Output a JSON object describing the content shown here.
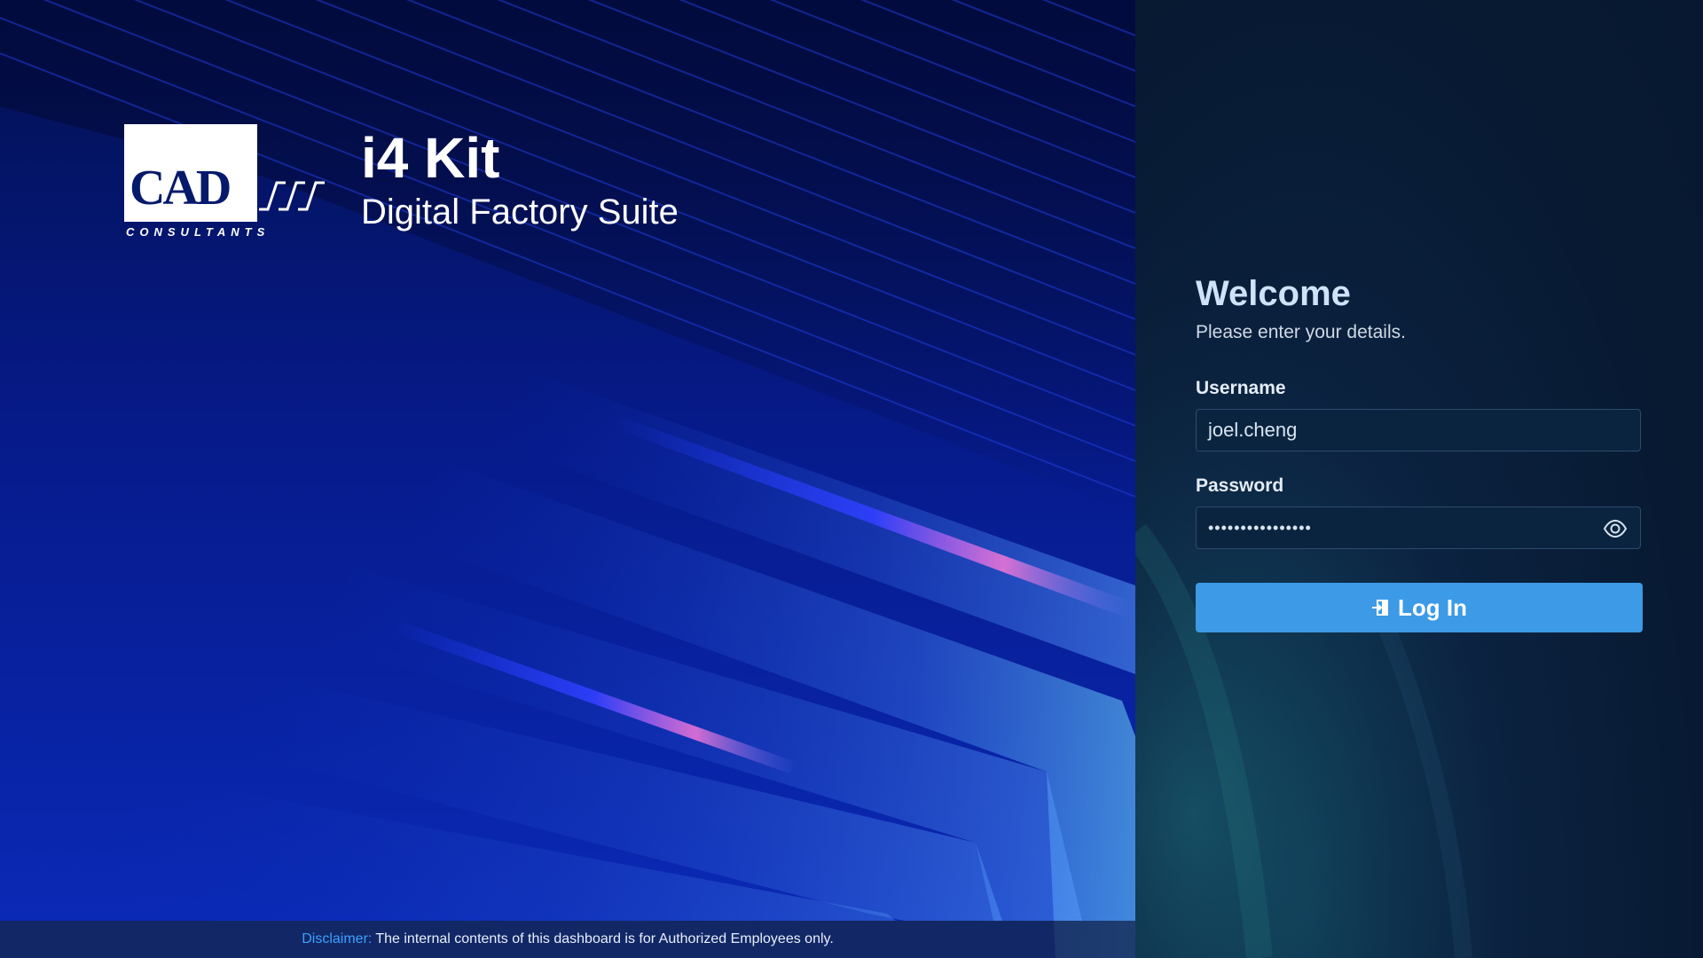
{
  "brand": {
    "logo_text": "CAD",
    "logo_subtext": "CONSULTANTS",
    "title": "i4 Kit",
    "subtitle": "Digital Factory Suite"
  },
  "login": {
    "heading": "Welcome",
    "subheading": "Please enter your details.",
    "username_label": "Username",
    "username_value": "joel.cheng",
    "password_label": "Password",
    "password_value": "••••••••••••••••",
    "login_button": "Log In"
  },
  "disclaimer": {
    "label": "Disclaimer:",
    "text": "The internal contents of this dashboard is for Authorized Employees only."
  },
  "colors": {
    "accent": "#3c9ae6",
    "disclaimer_label": "#3aa0ff",
    "panel_bg": "#081a33",
    "hero_bg": "#061a8a"
  },
  "icons": {
    "password_toggle": "eye-icon",
    "login": "login-icon"
  }
}
